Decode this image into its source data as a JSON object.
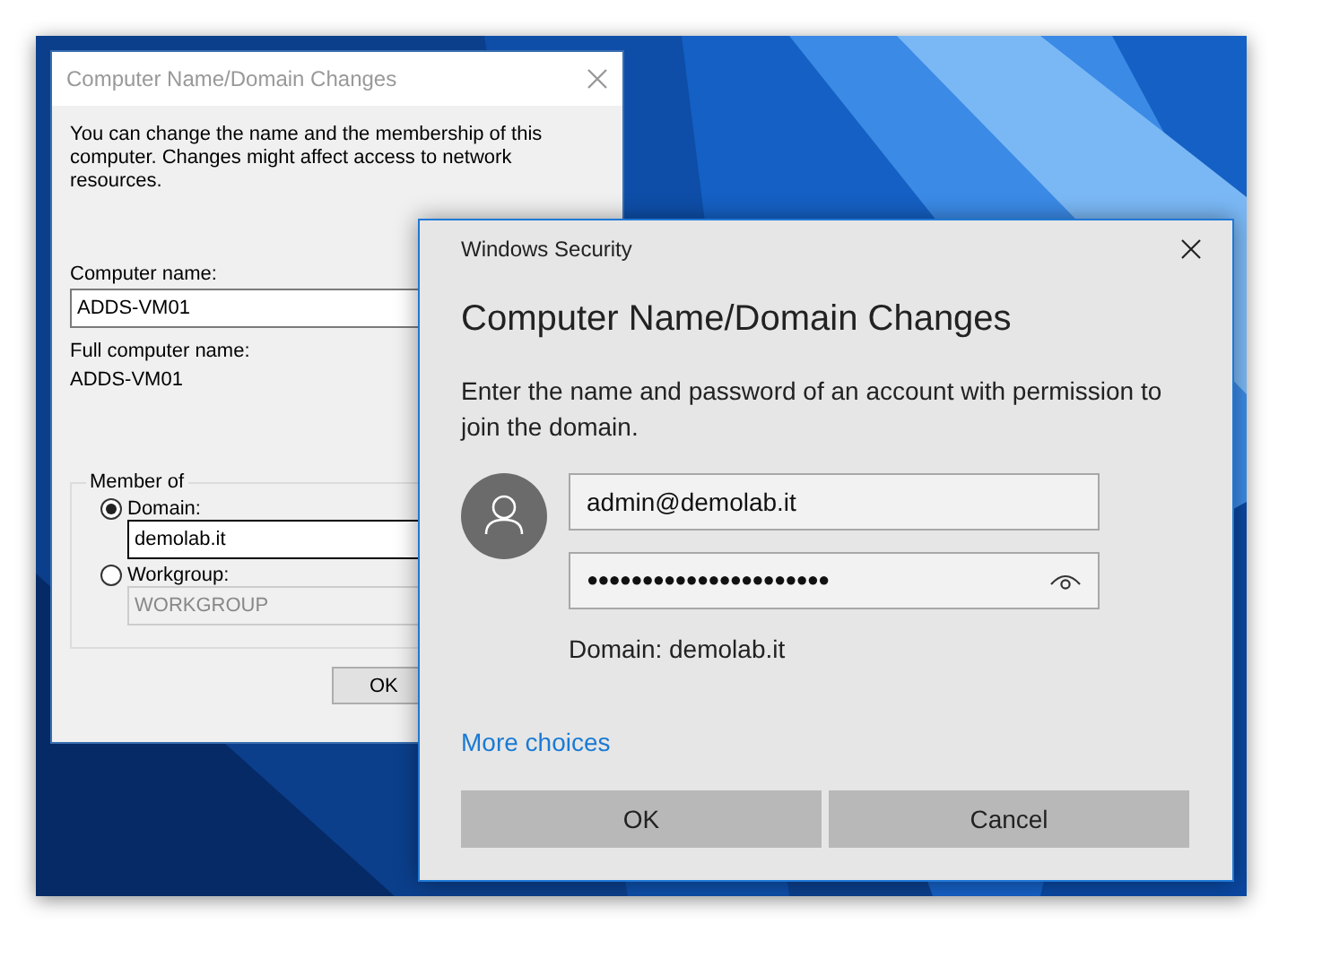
{
  "back_dialog": {
    "title": "Computer Name/Domain Changes",
    "description": "You can change the name and the membership of this computer. Changes might affect access to network resources.",
    "computer_name_label": "Computer name:",
    "computer_name": "ADDS-VM01",
    "full_name_label": "Full computer name:",
    "full_name": "ADDS-VM01",
    "member_of": {
      "legend": "Member of",
      "options": [
        {
          "label": "Domain:",
          "selected": true,
          "disabled": false,
          "value": "demolab.it"
        },
        {
          "label": "Workgroup:",
          "selected": false,
          "disabled": true,
          "value": "WORKGROUP"
        }
      ]
    },
    "buttons": [
      "OK"
    ]
  },
  "security_dialog": {
    "caption": "Windows Security",
    "title": "Computer Name/Domain Changes",
    "message": "Enter the name and password of an account with permission to join the domain.",
    "username": "admin@demolab.it",
    "password": "●●●●●●●●●●●●●●●●●●●●●●",
    "domain_note": "Domain: demolab.it",
    "link": "More choices",
    "buttons": [
      "OK",
      "Cancel"
    ]
  }
}
